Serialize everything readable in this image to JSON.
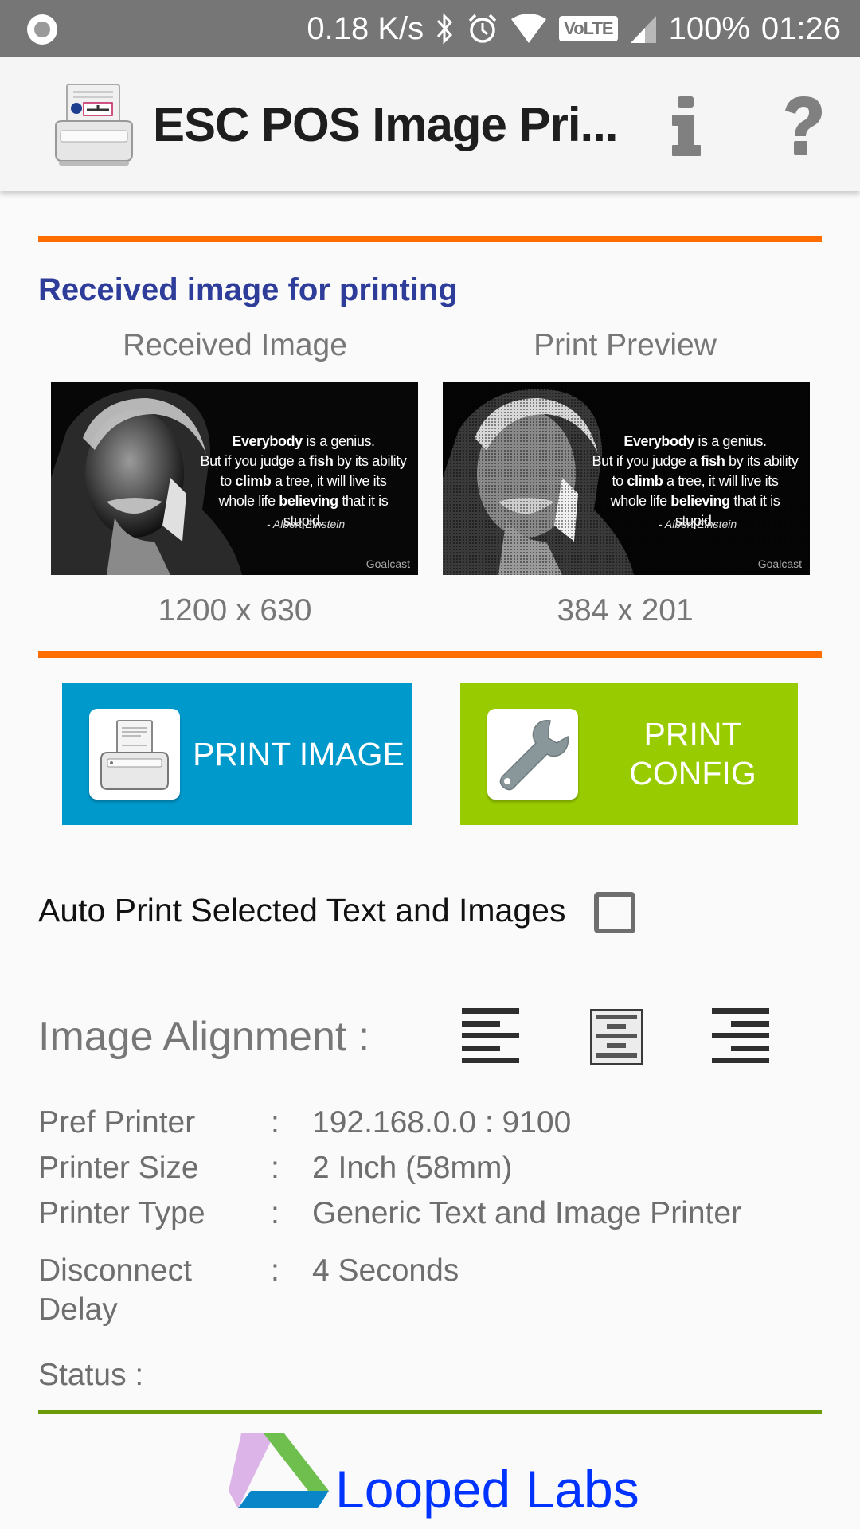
{
  "status_bar": {
    "net_speed": "0.18 K/s",
    "volte": "VoLTE",
    "battery": "100%",
    "time": "01:26",
    "icons": [
      "record-icon",
      "bluetooth-icon",
      "alarm-icon",
      "wifi-icon",
      "volte-icon",
      "signal-icon"
    ]
  },
  "app_bar": {
    "title": "ESC POS Image Pri...",
    "actions": [
      {
        "name": "info",
        "icon": "info-icon",
        "glyph": "i"
      },
      {
        "name": "help",
        "icon": "help-icon",
        "glyph": "?"
      }
    ]
  },
  "colors": {
    "accent_orange": "#ff6d00",
    "section_title": "#2e3d9a",
    "print_button": "#0099cc",
    "config_button": "#99cc00",
    "footer_divider": "#6b9b08",
    "brand_blue": "#0033ff"
  },
  "section": {
    "title": "Received image for printing"
  },
  "images": {
    "received": {
      "label": "Received Image",
      "dimensions": "1200 x 630"
    },
    "preview": {
      "label": "Print Preview",
      "dimensions": "384 x 201"
    },
    "quote": {
      "line1_bold": "Everybody",
      "line1_rest": " is a genius.",
      "line2_pre": "But if you judge a ",
      "line2_bold": "fish",
      "line2_rest": " by its ability",
      "line3_pre": "to ",
      "line3_bold": "climb",
      "line3_rest": " a tree, it will live its",
      "line4_pre": "whole life ",
      "line4_bold": "believing",
      "line4_rest": " that it is stupid.",
      "author": "- Albert Einstein",
      "brand": "Goalcast"
    }
  },
  "buttons": {
    "print_image": "PRINT IMAGE",
    "print_config_line1": "PRINT",
    "print_config_line2": "CONFIG"
  },
  "auto_print": {
    "label": "Auto Print Selected Text and Images",
    "checked": false
  },
  "alignment": {
    "label": "Image Alignment :",
    "options": [
      "left",
      "center",
      "right"
    ],
    "selected": "center"
  },
  "info": [
    {
      "key": "Pref Printer",
      "value": "192.168.0.0 : 9100"
    },
    {
      "key": "Printer Size",
      "value": "2 Inch (58mm)"
    },
    {
      "key": "Printer Type",
      "value": "Generic Text and Image Printer"
    },
    {
      "key": "Disconnect Delay",
      "value": "4 Seconds"
    }
  ],
  "info_colon": ":",
  "status": {
    "label": "Status :",
    "value": ""
  },
  "footer": {
    "brand": "Looped Labs"
  }
}
